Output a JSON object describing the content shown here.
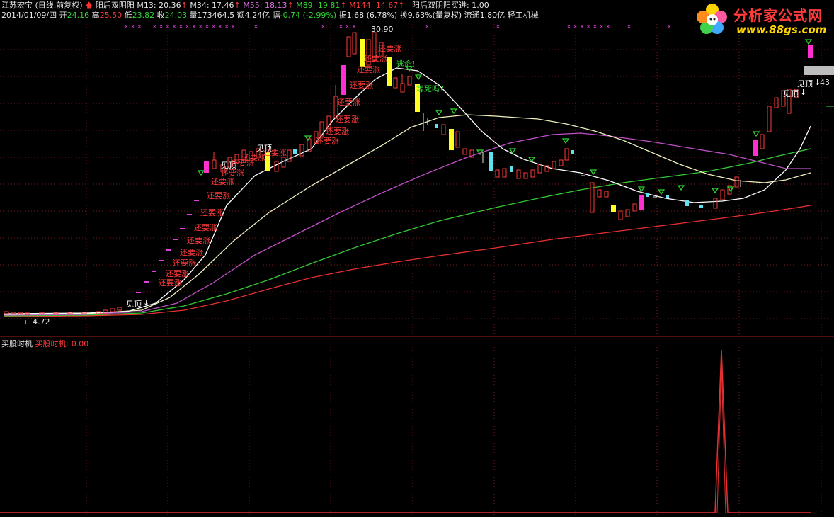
{
  "header": {
    "stock_name": "江苏宏宝",
    "period": "(日线,前复权)",
    "indicator_name": "阳后双阴阳",
    "ma": [
      {
        "label": "M13:",
        "value": "20.36",
        "color": "#e6e6e6"
      },
      {
        "label": "M34:",
        "value": "17.46",
        "color": "#e6e6e6"
      },
      {
        "label": "M55:",
        "value": "18.13",
        "color": "#e070e0"
      },
      {
        "label": "M89:",
        "value": "19.81",
        "color": "#31d631"
      },
      {
        "label": "M144:",
        "value": "14.67",
        "color": "#ff3b3b"
      }
    ],
    "buy_signal_label": "阳后双阴阳买进:",
    "buy_signal_value": "1.00",
    "date": "2014/01/09/四",
    "open_label": "开",
    "open": "24.16",
    "high_label": "高",
    "high": "25.50",
    "low_label": "低",
    "low": "23.82",
    "close_label": "收",
    "close": "24.03",
    "volume_label": "量",
    "volume": "173464.5",
    "amount_label": "额",
    "amount": "4.24亿",
    "change_label": "幅",
    "change": "-0.74 (-2.99%)",
    "amplitude_label": "振",
    "amplitude": "1.68 (6.78%)",
    "turnover_label": "换",
    "turnover": "9.63%(量复权)",
    "float_label": "流通",
    "float": "1.80亿",
    "industry": "轻工机械"
  },
  "chart_labels": {
    "max_price": "30.90",
    "min_price": "4.72",
    "right_price": "43",
    "top_label": "见顶",
    "escape_label": "逃命!",
    "hesitate_label": "等死吗?",
    "still_rise_label": "还要涨"
  },
  "sub_panel": {
    "title": "买股时机",
    "value_label": "买股时机:",
    "value": "0.00"
  },
  "logo": {
    "title": "分析家公式网",
    "url": "www.88gs.com"
  },
  "colors": {
    "up": "#ff3b3b",
    "down": "#31d631",
    "ma13": "#e6e6e6",
    "ma34": "#e6e6e6",
    "ma55": "#e070e0",
    "ma89": "#31d631",
    "ma144": "#ff3b3b",
    "signal_magenta": "#ff2fd0",
    "signal_yellow": "#ffff20",
    "signal_cyan": "#60e0f0"
  }
}
